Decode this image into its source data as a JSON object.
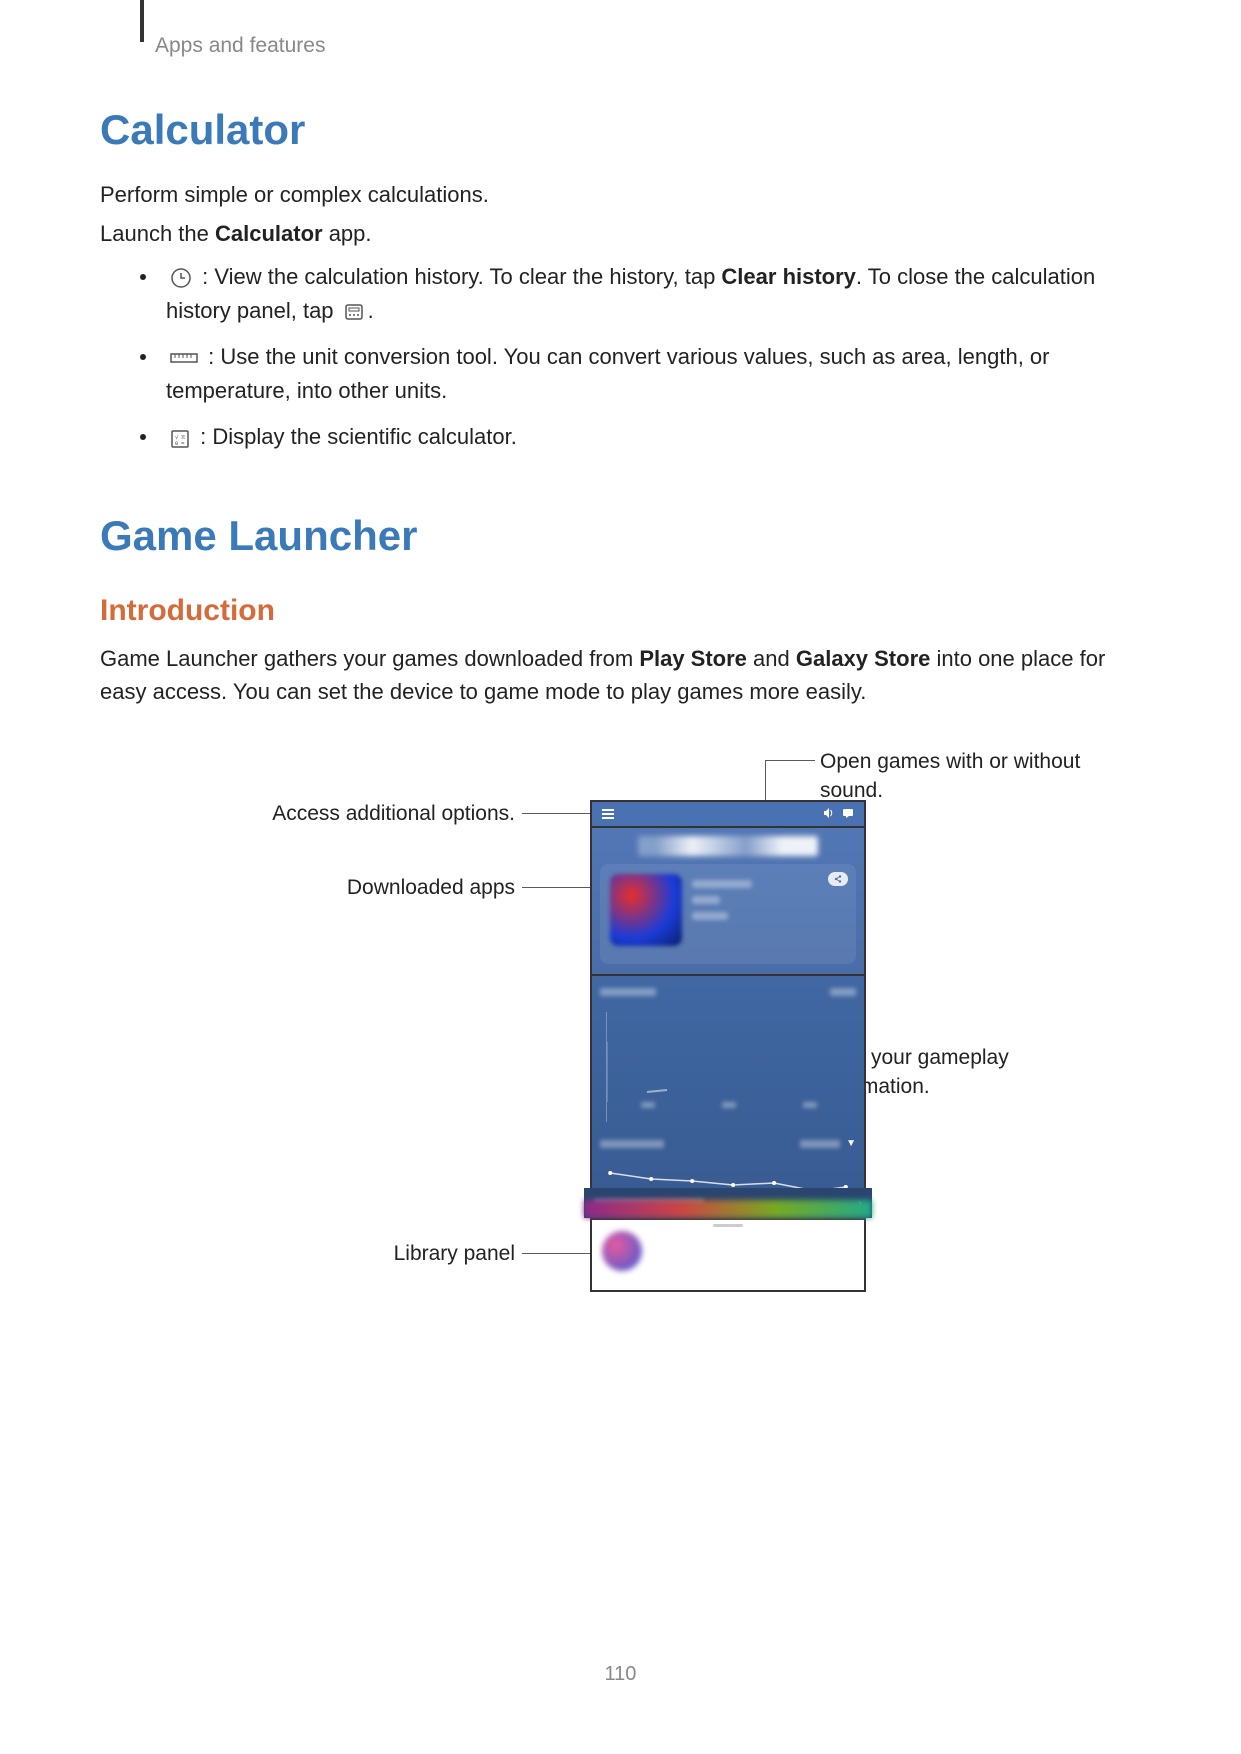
{
  "header": {
    "breadcrumb": "Apps and features"
  },
  "calculator": {
    "heading": "Calculator",
    "intro": "Perform simple or complex calculations.",
    "launch_pre": "Launch the ",
    "launch_bold": "Calculator",
    "launch_post": " app.",
    "bullet1_pre": " : View the calculation history. To clear the history, tap ",
    "bullet1_bold": "Clear history",
    "bullet1_mid": ". To close the calculation history panel, tap ",
    "bullet1_post": ".",
    "bullet2": " : Use the unit conversion tool. You can convert various values, such as area, length, or temperature, into other units.",
    "bullet3": " : Display the scientific calculator."
  },
  "gamelauncher": {
    "heading": "Game Launcher",
    "subheading": "Introduction",
    "intro_pre": "Game Launcher gathers your games downloaded from ",
    "intro_bold1": "Play Store",
    "intro_mid": " and ",
    "intro_bold2": "Galaxy Store",
    "intro_post": " into one place for easy access. You can set the device to game mode to play games more easily."
  },
  "callouts": {
    "sound": "Open games with or without sound.",
    "options": "Access additional options.",
    "downloaded": "Downloaded apps",
    "gameplay": "View your gameplay information.",
    "library": "Library panel"
  },
  "page_number": "110"
}
